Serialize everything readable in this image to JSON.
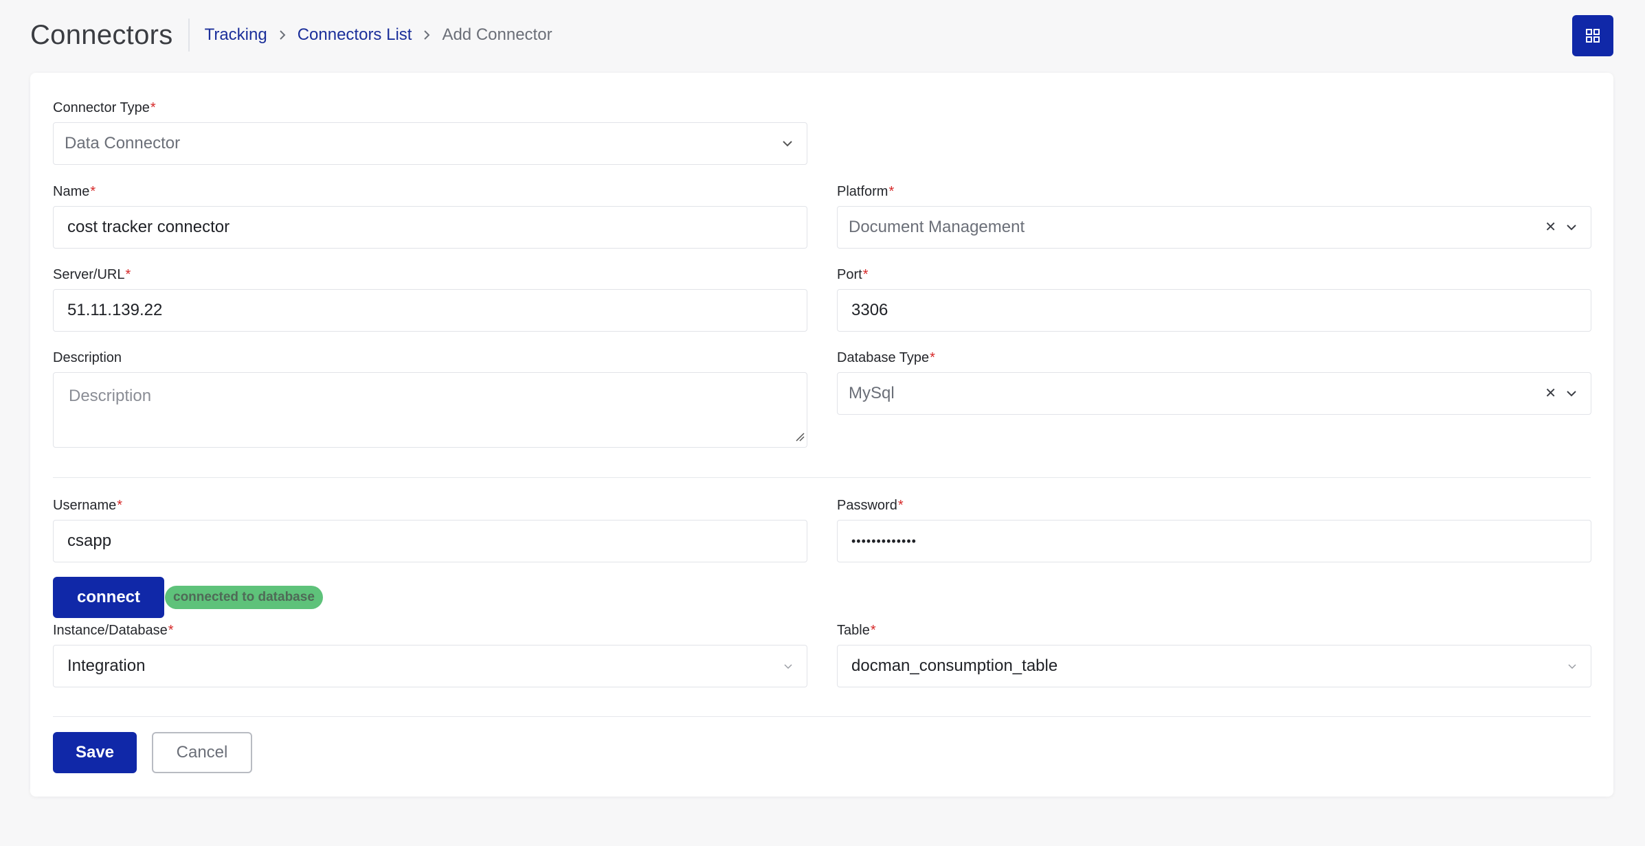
{
  "header": {
    "title": "Connectors",
    "breadcrumb": {
      "items": [
        "Tracking",
        "Connectors List"
      ],
      "current": "Add Connector"
    }
  },
  "form": {
    "connector_type": {
      "label": "Connector Type",
      "value": "Data Connector"
    },
    "name": {
      "label": "Name",
      "value": "cost tracker connector"
    },
    "platform": {
      "label": "Platform",
      "value": "Document Management"
    },
    "server": {
      "label": "Server/URL",
      "value": "51.11.139.22"
    },
    "port": {
      "label": "Port",
      "value": "3306"
    },
    "description": {
      "label": "Description",
      "placeholder": "Description"
    },
    "database_type": {
      "label": "Database Type",
      "value": "MySql"
    },
    "username": {
      "label": "Username",
      "value": "csapp"
    },
    "password": {
      "label": "Password",
      "value": "•••••••••••••"
    },
    "connect_label": "connect",
    "status": "connected to database",
    "instance": {
      "label": "Instance/Database",
      "value": "Integration"
    },
    "table": {
      "label": "Table",
      "value": "docman_consumption_table"
    },
    "required_mark": "*"
  },
  "actions": {
    "save_label": "Save",
    "cancel_label": "Cancel"
  },
  "colors": {
    "primary": "#1028a8",
    "link": "#1b2f9a",
    "required": "#d62828",
    "success": "#5ec27a"
  }
}
